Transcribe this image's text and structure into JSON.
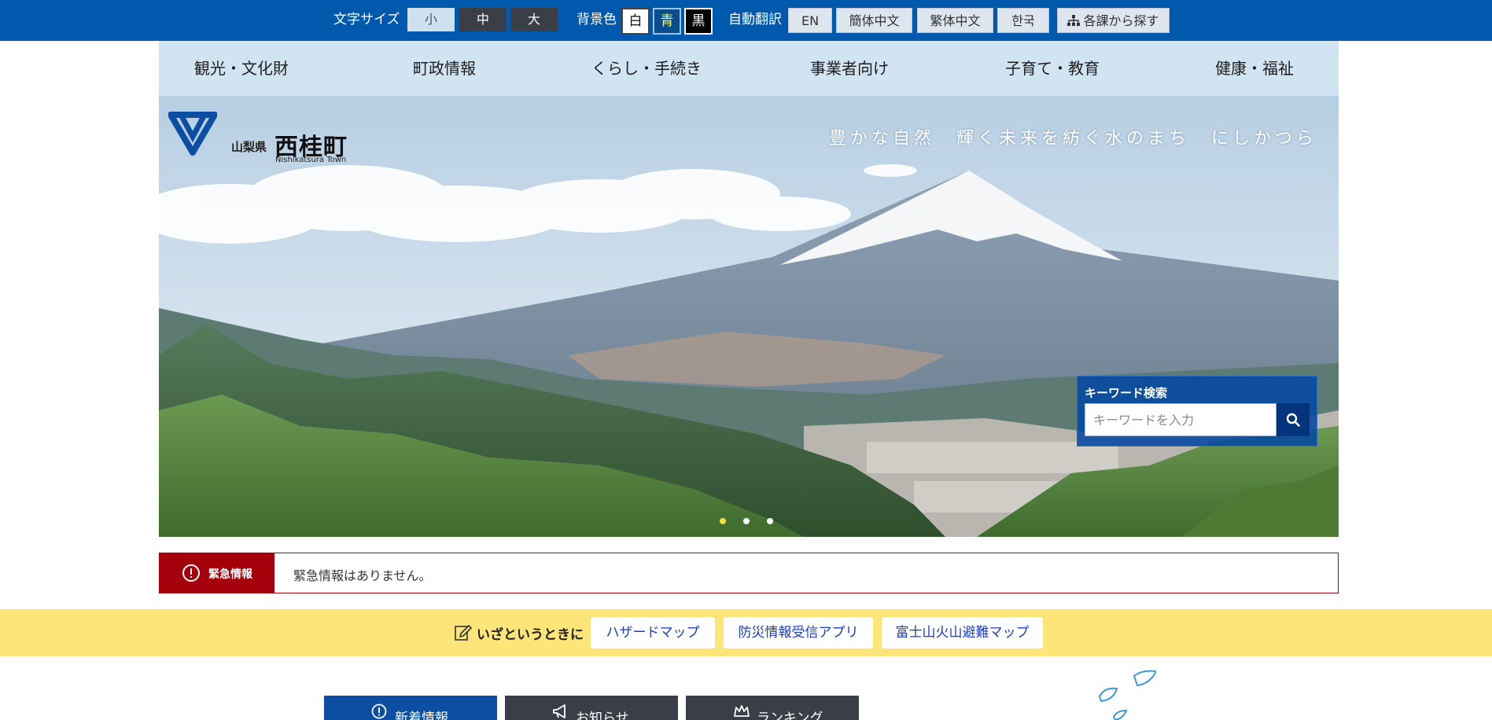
{
  "utility_bar": {
    "font_size": {
      "label": "文字サイズ",
      "options": [
        "小",
        "中",
        "大"
      ],
      "selected": "小"
    },
    "background": {
      "label": "背景色",
      "options": [
        "白",
        "青",
        "黒"
      ]
    },
    "translate": {
      "label": "自動翻訳",
      "options": [
        "EN",
        "簡体中文",
        "繁体中文",
        "한국"
      ]
    },
    "find_by_section": "各課から探す",
    "find_icon": "sitemap-icon",
    "color": "#0059ad"
  },
  "global_nav": {
    "items": [
      "観光・文化財",
      "町政情報",
      "くらし・手続き",
      "事業者向け",
      "子育て・教育",
      "健康・福祉"
    ],
    "color": "#d0e4f2"
  },
  "hero": {
    "logo": {
      "prefecture": "山梨県",
      "town": "西桂町",
      "town_en": "Nishikatsura Town",
      "icon": "town-emblem-icon"
    },
    "catchphrase": "豊かな自然　輝く未来を紡ぐ水のまち　にしかつら",
    "slides": {
      "count": 3,
      "active": 1
    },
    "search": {
      "title": "キーワード検索",
      "placeholder": "キーワードを入力",
      "button_icon": "search-icon",
      "color": "#0448a0"
    }
  },
  "emergency": {
    "label": "緊急情報",
    "icon": "alert-circle-icon",
    "message": "緊急情報はありません。",
    "color": "#a3000b"
  },
  "disaster": {
    "lead": "いざというときに",
    "icon": "note-edit-icon",
    "links": [
      "ハザードマップ",
      "防災情報受信アプリ",
      "富士山火山避難マップ"
    ],
    "color": "#fde57a"
  },
  "tabs": {
    "items": [
      {
        "label": "新着情報",
        "icon": "alert-circle-icon",
        "active": true
      },
      {
        "label": "お知らせ",
        "icon": "megaphone-icon",
        "active": false
      },
      {
        "label": "ランキング",
        "icon": "crown-icon",
        "active": false
      }
    ],
    "active_color": "#0b4ea2",
    "inactive_color": "#3a3f47"
  }
}
